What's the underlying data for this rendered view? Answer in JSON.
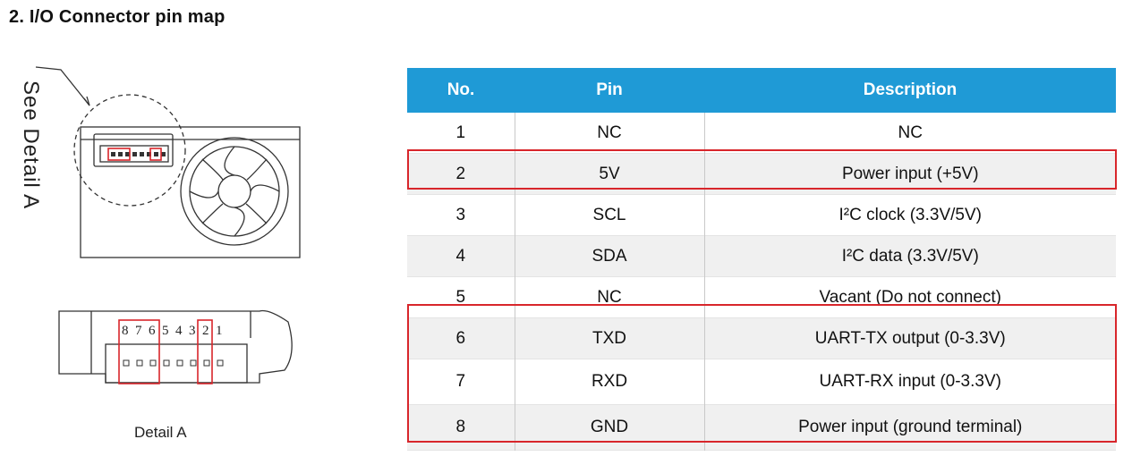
{
  "heading": "2. I/O Connector pin map",
  "diagram": {
    "side_label": "See Detail A",
    "caption": "Detail A",
    "pin_numbers": [
      "8",
      "7",
      "6",
      "5",
      "4",
      "3",
      "2",
      "1"
    ]
  },
  "table": {
    "headers": {
      "no": "No.",
      "pin": "Pin",
      "description": "Description"
    },
    "rows": [
      {
        "no": "1",
        "pin": "NC",
        "description": "NC"
      },
      {
        "no": "2",
        "pin": "5V",
        "description": "Power input (+5V)"
      },
      {
        "no": "3",
        "pin": "SCL",
        "description": "I²C clock (3.3V/5V)"
      },
      {
        "no": "4",
        "pin": "SDA",
        "description": "I²C data (3.3V/5V)"
      },
      {
        "no": "5",
        "pin": "NC",
        "description": "Vacant (Do not connect)"
      },
      {
        "no": "6",
        "pin": "TXD",
        "description": "UART-TX output (0-3.3V)"
      },
      {
        "no": "7",
        "pin": "RXD",
        "description": "UART-RX input (0-3.3V)"
      },
      {
        "no": "8",
        "pin": "GND",
        "description": "Power input (ground terminal)"
      }
    ]
  },
  "colors": {
    "header_bg": "#1f9ad6",
    "highlight": "#d8262b",
    "alt_row": "#f0f0f0"
  }
}
